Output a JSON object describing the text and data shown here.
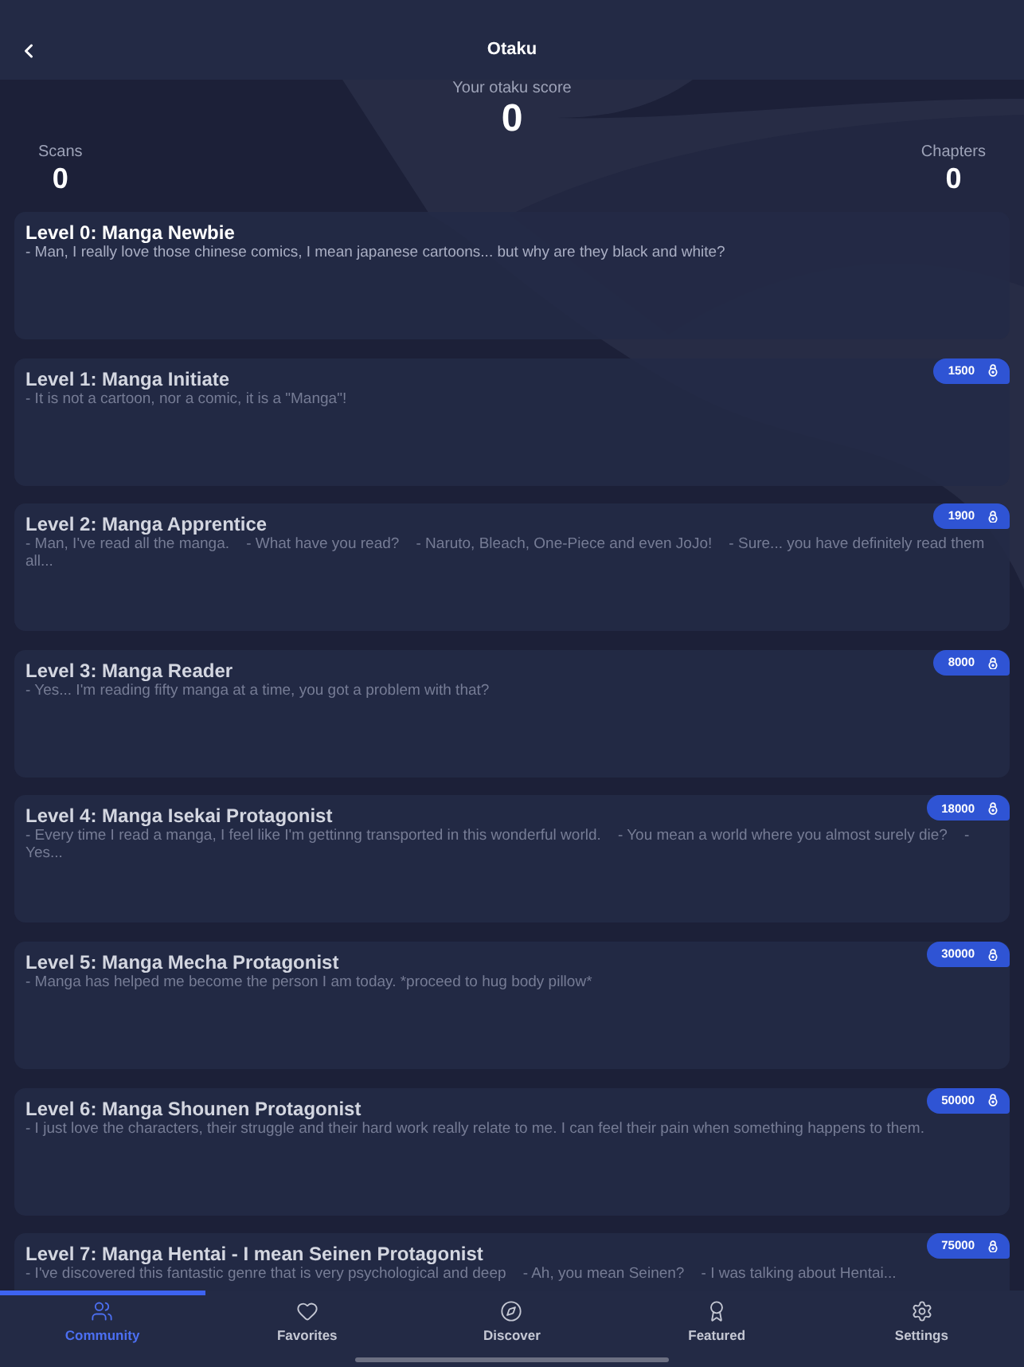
{
  "header": {
    "title": "Otaku"
  },
  "score": {
    "label": "Your otaku score",
    "value": "0"
  },
  "stats": [
    {
      "label": "Scans",
      "value": "0"
    },
    {
      "label": "Chapters",
      "value": "0"
    }
  ],
  "levels": [
    {
      "title": "Level 0: Manga Newbie",
      "description": "- Man, I really love those chinese comics, I mean japanese cartoons... but why are they black and white?",
      "locked": false
    },
    {
      "title": "Level 1: Manga Initiate",
      "description": "- It is not a cartoon, nor a comic, it is a \"Manga\"!",
      "locked": true,
      "cost": "1500"
    },
    {
      "title": "Level 2: Manga Apprentice",
      "description": "- Man, I've read all the manga.    - What have you read?    - Naruto, Bleach, One-Piece and even JoJo!    - Sure... you have definitely read them all...",
      "locked": true,
      "cost": "1900"
    },
    {
      "title": "Level 3: Manga Reader",
      "description": "- Yes... I'm reading fifty manga at a time, you got a problem with that?",
      "locked": true,
      "cost": "8000"
    },
    {
      "title": "Level 4: Manga Isekai Protagonist",
      "description": "- Every time I read a manga, I feel like I'm gettinng transported in this wonderful world.    - You mean a world where you almost surely die?    - Yes...",
      "locked": true,
      "cost": "18000"
    },
    {
      "title": "Level 5: Manga Mecha Protagonist",
      "description": "- Manga has helped me become the person I am today. *proceed to hug body pillow*",
      "locked": true,
      "cost": "30000"
    },
    {
      "title": "Level 6: Manga Shounen Protagonist",
      "description": "- I just love the characters, their struggle and their hard work really relate to me. I can feel their pain when something happens to them.",
      "locked": true,
      "cost": "50000"
    },
    {
      "title": "Level 7: Manga Hentai - I mean Seinen Protagonist",
      "description": "- I've discovered this fantastic genre that is very psychological and deep    - Ah, you mean Seinen?    - I was talking about Hentai...",
      "locked": true,
      "cost": "75000"
    }
  ],
  "tab_bar": {
    "tabs": [
      {
        "label": "Community",
        "selected": true
      },
      {
        "label": "Favorites",
        "selected": false
      },
      {
        "label": "Discover",
        "selected": false
      },
      {
        "label": "Featured",
        "selected": false
      },
      {
        "label": "Settings",
        "selected": false
      }
    ]
  }
}
